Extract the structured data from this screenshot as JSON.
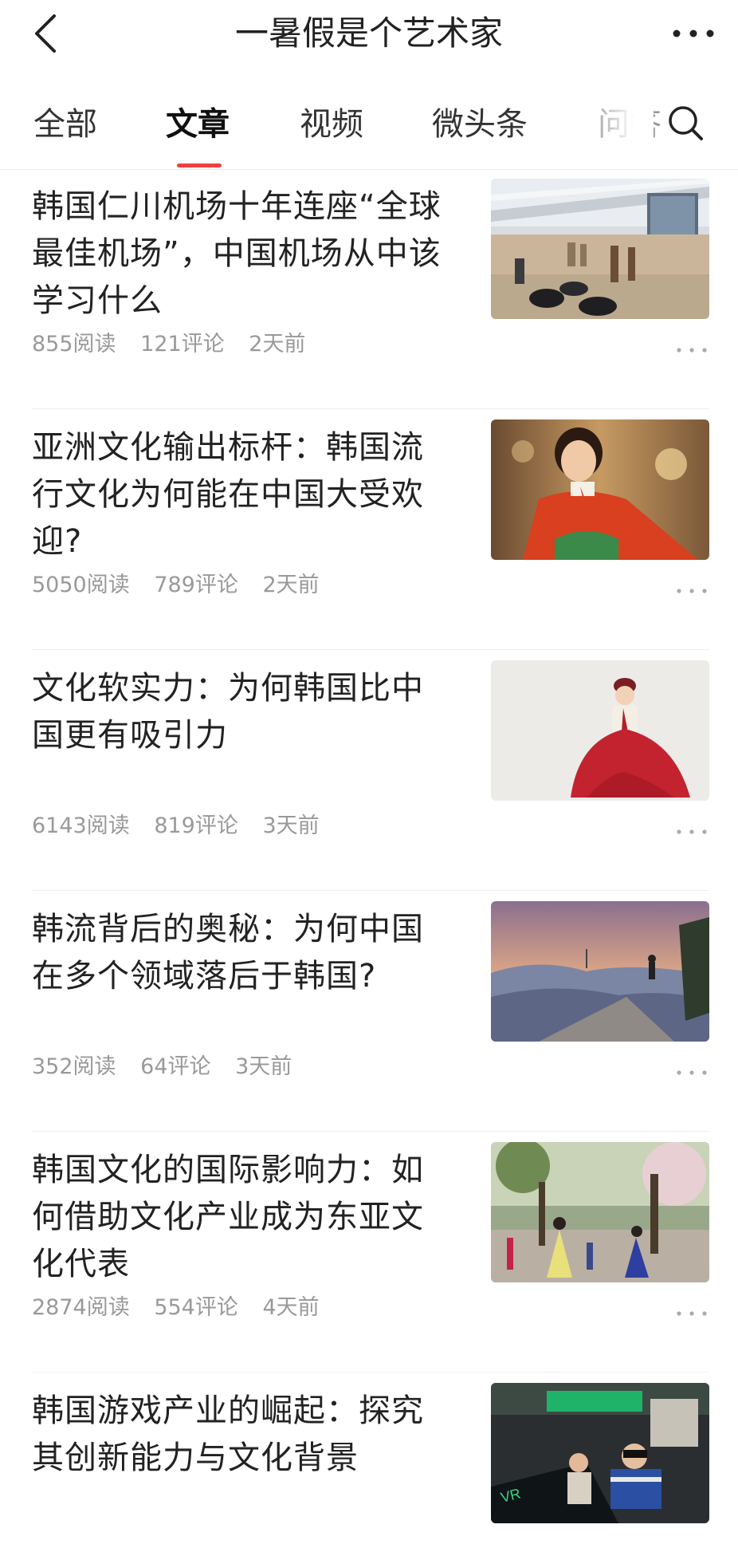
{
  "header": {
    "title": "一暑假是个艺术家",
    "back_icon": "back-chevron-icon",
    "more_icon": "more-dots-icon"
  },
  "tabs": [
    {
      "label": "全部",
      "active": false
    },
    {
      "label": "文章",
      "active": true
    },
    {
      "label": "视频",
      "active": false
    },
    {
      "label": "微头条",
      "active": false
    },
    {
      "label": "问答",
      "active": false
    }
  ],
  "search": {
    "icon": "search-icon"
  },
  "accent_color": "#f04142",
  "articles": [
    {
      "title": "韩国仁川机场十年连座“全球最佳机场”，中国机场从中该学习什么",
      "reads": "855阅读",
      "comments": "121评论",
      "time": "2天前",
      "image": "airport-terminal-photo"
    },
    {
      "title": "亚洲文化输出标杆：韩国流行文化为何能在中国大受欢迎?",
      "reads": "5050阅读",
      "comments": "789评论",
      "time": "2天前",
      "image": "hanbok-doll-photo"
    },
    {
      "title": "文化软实力：为何韩国比中国更有吸引力",
      "reads": "6143阅读",
      "comments": "819评论",
      "time": "3天前",
      "image": "woman-in-hanbok-photo"
    },
    {
      "title": "韩流背后的奥秘：为何中国在多个领域落后于韩国?",
      "reads": "352阅读",
      "comments": "64评论",
      "time": "3天前",
      "image": "seoul-city-view-photo"
    },
    {
      "title": "韩国文化的国际影响力：如何借助文化产业成为东亚文化代表",
      "reads": "2874阅读",
      "comments": "554评论",
      "time": "4天前",
      "image": "hanbok-park-photo"
    },
    {
      "title": "韩国游戏产业的崛起：探究其创新能力与文化背景",
      "reads": "",
      "comments": "",
      "time": "",
      "image": "vr-arcade-photo"
    }
  ]
}
